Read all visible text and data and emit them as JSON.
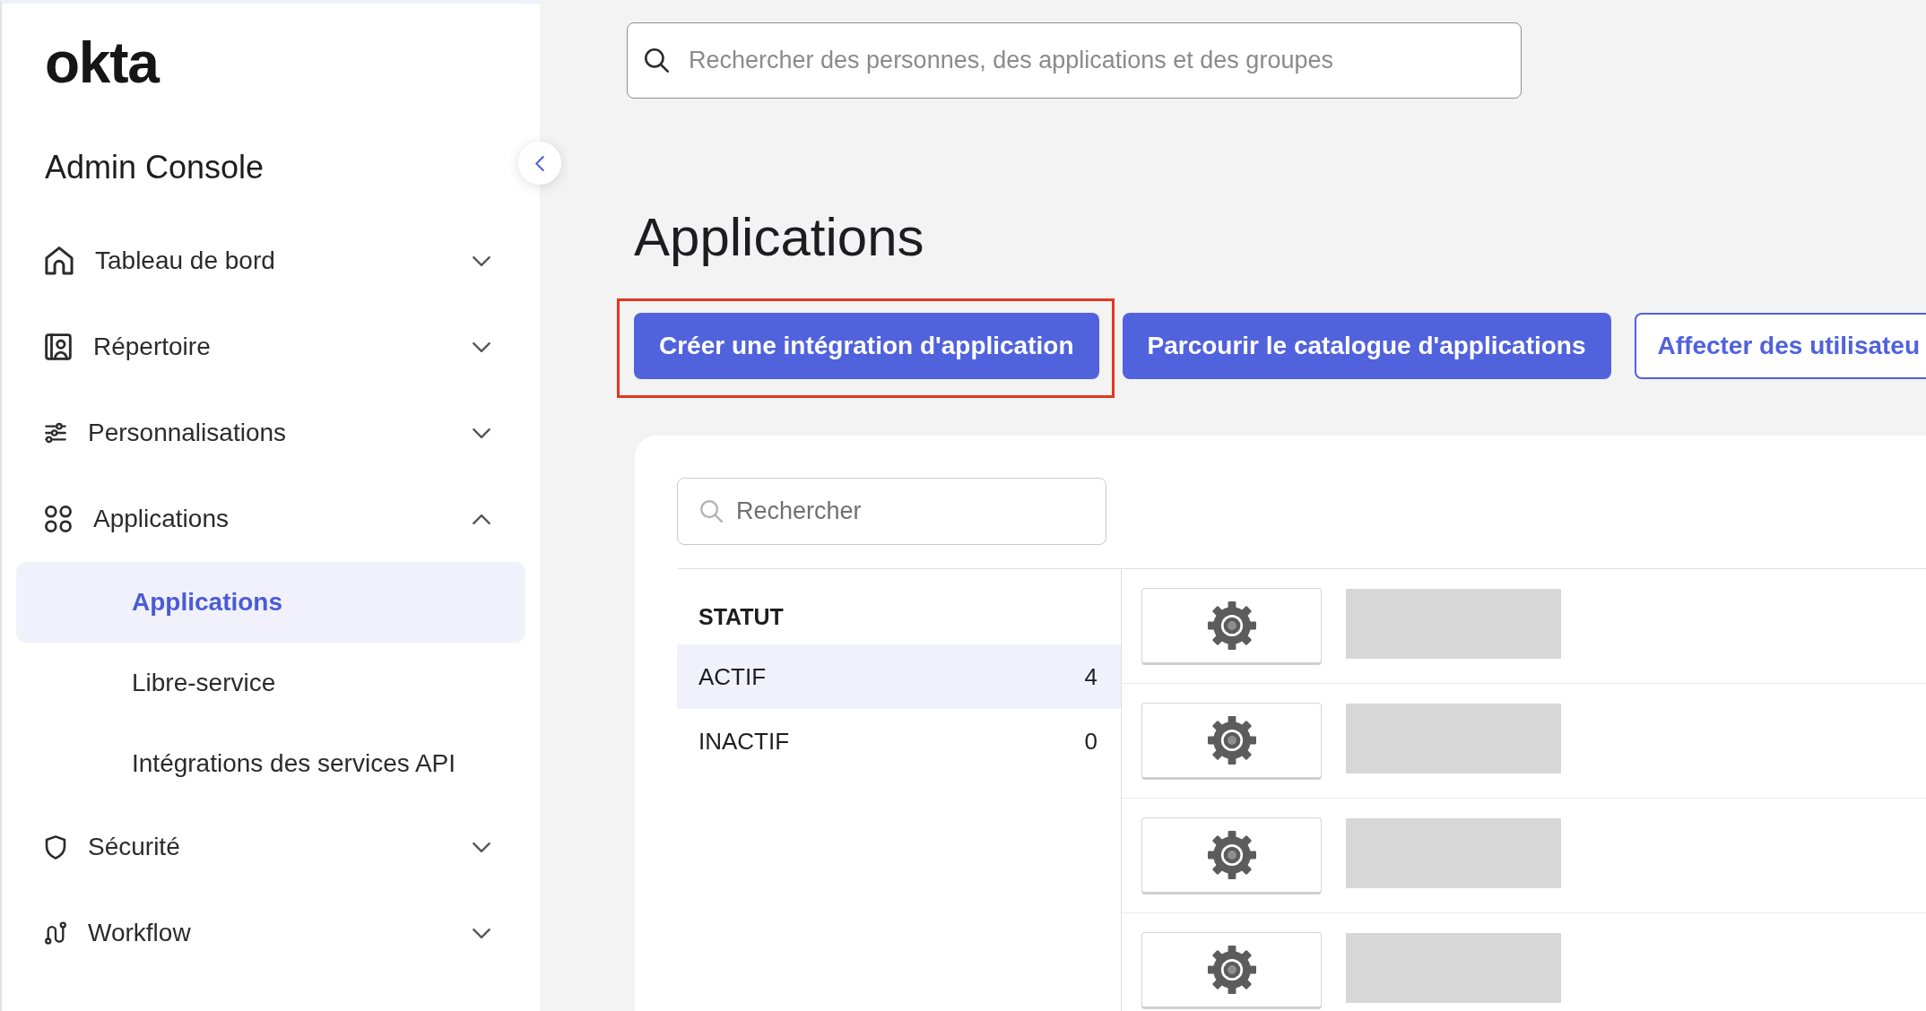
{
  "sidebar": {
    "logo": "okta",
    "title": "Admin Console",
    "items": [
      {
        "label": "Tableau de bord",
        "expanded": false
      },
      {
        "label": "Répertoire",
        "expanded": false
      },
      {
        "label": "Personnalisations",
        "expanded": false
      },
      {
        "label": "Applications",
        "expanded": true,
        "children": [
          {
            "label": "Applications",
            "selected": true
          },
          {
            "label": "Libre-service",
            "selected": false
          },
          {
            "label": "Intégrations des services API",
            "selected": false
          }
        ]
      },
      {
        "label": "Sécurité",
        "expanded": false
      },
      {
        "label": "Workflow",
        "expanded": false
      }
    ]
  },
  "main": {
    "search": {
      "placeholder": "Rechercher des personnes, des applications et des groupes"
    },
    "title": "Applications",
    "actions": [
      {
        "label": "Créer une intégration d'application",
        "kind": "primary",
        "highlighted": true
      },
      {
        "label": "Parcourir le catalogue d'applications",
        "kind": "primary",
        "highlighted": false
      },
      {
        "label": "Affecter des utilisateu",
        "kind": "secondary",
        "highlighted": false
      }
    ],
    "filter": {
      "search": {
        "placeholder": "Rechercher"
      },
      "heading": "STATUT",
      "options": [
        {
          "label": "ACTIF",
          "count": "4",
          "selected": true
        },
        {
          "label": "INACTIF",
          "count": "0",
          "selected": false
        }
      ]
    },
    "app_rows": [
      {
        "redacted": true
      },
      {
        "redacted": true
      },
      {
        "redacted": true
      },
      {
        "redacted": true
      }
    ]
  }
}
